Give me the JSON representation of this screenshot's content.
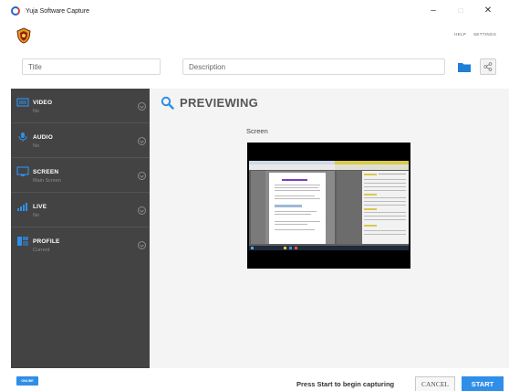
{
  "window": {
    "title": "Yuja Software Capture",
    "controls": {
      "minimize": "–",
      "maximize": "□",
      "close": "✕"
    }
  },
  "header": {
    "help_label": "HELP",
    "settings_label": "SETTINGS"
  },
  "form": {
    "title_placeholder": "Title",
    "description_placeholder": "Description"
  },
  "sidebar": {
    "items": [
      {
        "label": "VIDEO",
        "sub": "No",
        "icon": "video-icon"
      },
      {
        "label": "AUDIO",
        "sub": "No",
        "icon": "microphone-icon"
      },
      {
        "label": "SCREEN",
        "sub": "Main Screen",
        "icon": "monitor-icon"
      },
      {
        "label": "LIVE",
        "sub": "No",
        "icon": "signal-icon"
      },
      {
        "label": "PROFILE",
        "sub": "Current",
        "icon": "profile-icon"
      }
    ]
  },
  "preview": {
    "heading": "PREVIEWING",
    "screen_label": "Screen"
  },
  "footer": {
    "online_badge": "ONLINE",
    "status_text": "Press Start to begin capturing",
    "cancel_label": "CANCEL",
    "start_label": "START"
  },
  "colors": {
    "accent": "#2f8ee8",
    "sidebar_bg": "#434343",
    "content_bg": "#f4f4f4"
  }
}
